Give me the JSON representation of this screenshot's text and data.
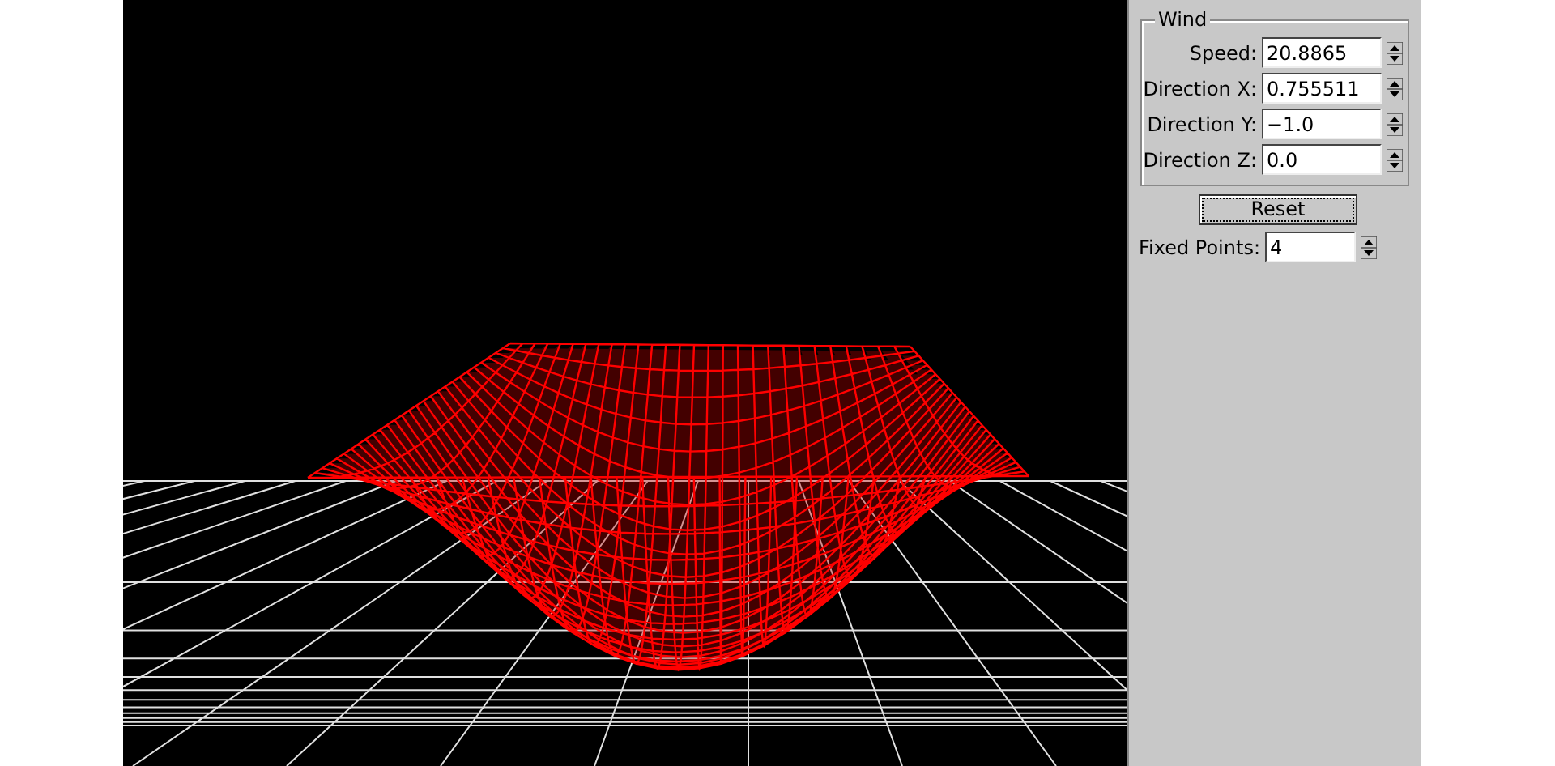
{
  "wind": {
    "title": "Wind",
    "fields": [
      {
        "label": "Speed:",
        "value": "20.8865"
      },
      {
        "label": "Direction X:",
        "value": "0.755511"
      },
      {
        "label": "Direction Y:",
        "value": "−1.0"
      },
      {
        "label": "Direction Z:",
        "value": "0.0"
      }
    ]
  },
  "reset_button": "Reset",
  "fixed_points": {
    "label": "Fixed Points:",
    "value": "4"
  }
}
